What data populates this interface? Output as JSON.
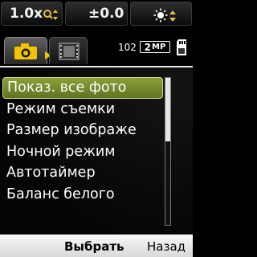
{
  "status_bar": {
    "zoom": "1.0x",
    "exposure": "±0.0",
    "zoom_icon": "magnifier-updown-icon",
    "wb_icon": "sun-icon"
  },
  "mode_bar": {
    "active_tab_icon": "camera-icon",
    "video_tab_icon": "film-icon",
    "photo_count": "102",
    "resolution_number": "2",
    "resolution_unit": "MP",
    "memory_icon": "memory-card-icon"
  },
  "menu": {
    "items": [
      {
        "label": "Показ. все фото",
        "selected": true
      },
      {
        "label": "Режим съемки",
        "selected": false
      },
      {
        "label": "Размер изображе",
        "selected": false
      },
      {
        "label": "Ночной режим",
        "selected": false
      },
      {
        "label": "Автотаймер",
        "selected": false
      },
      {
        "label": "Баланс белого",
        "selected": false
      }
    ],
    "scroll_fraction_visible": 0.43
  },
  "softkeys": {
    "select": "Выбрать",
    "back": "Назад"
  },
  "colors": {
    "selected_highlight": "#7a9130",
    "background": "#000000",
    "softkey_bar": "#e6e6e6"
  }
}
